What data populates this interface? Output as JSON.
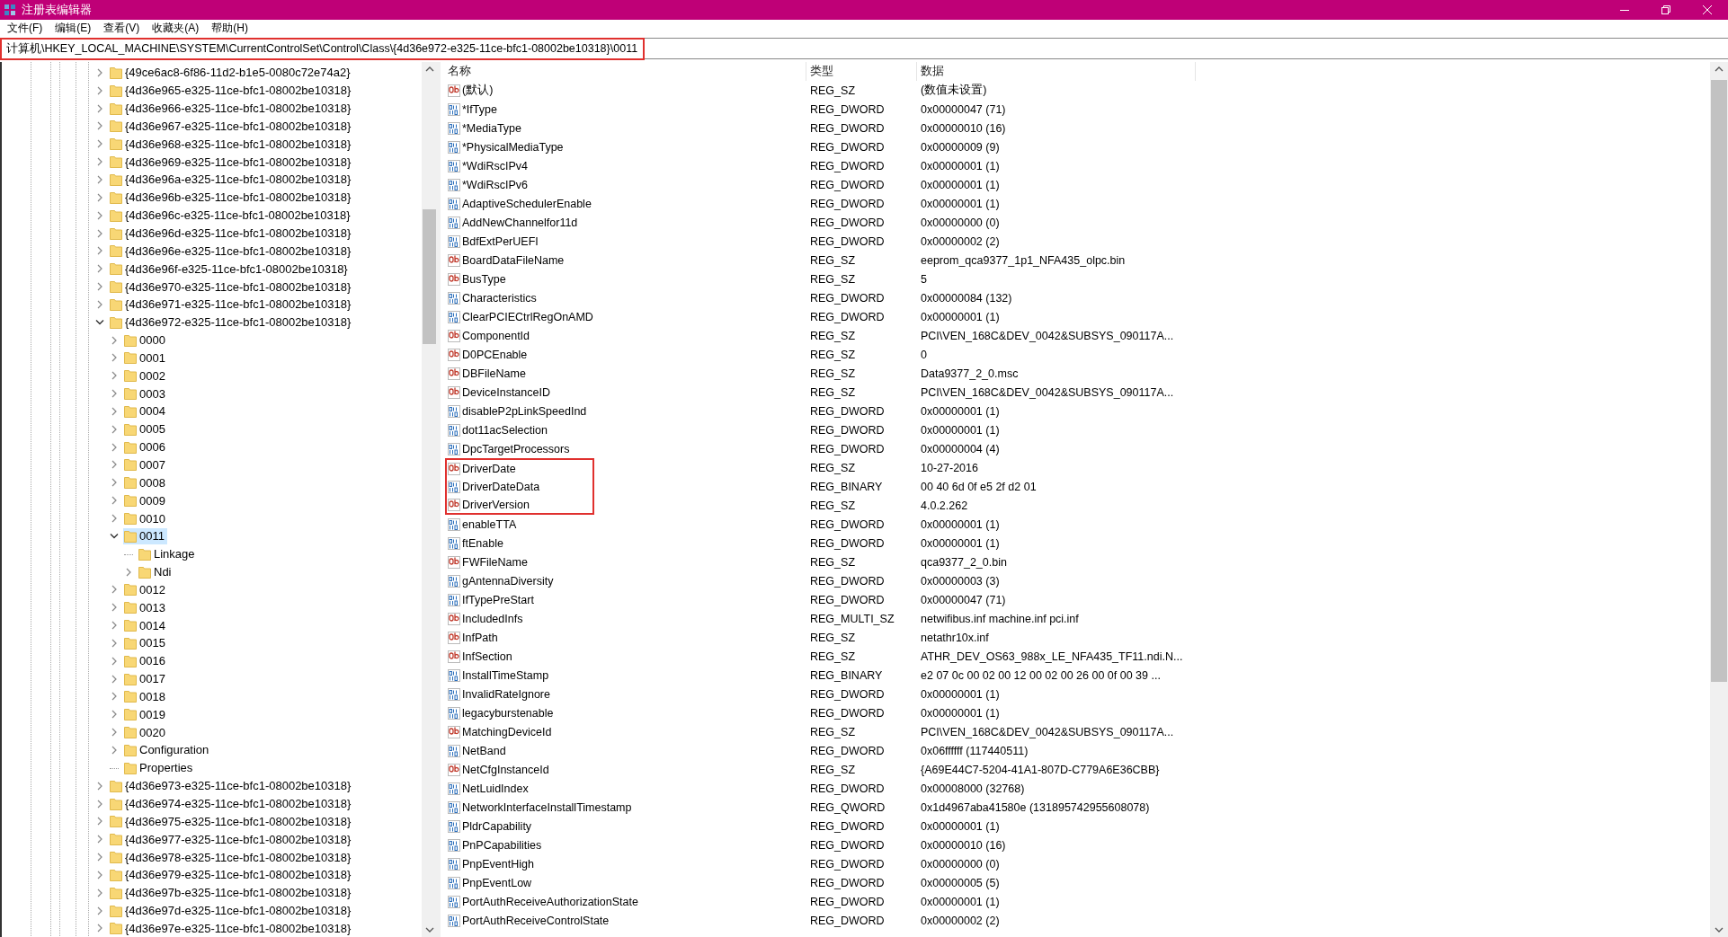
{
  "window": {
    "title": "注册表编辑器"
  },
  "menu": [
    "文件(F)",
    "编辑(E)",
    "查看(V)",
    "收藏夹(A)",
    "帮助(H)"
  ],
  "address": {
    "value": "计算机\\HKEY_LOCAL_MACHINE\\SYSTEM\\CurrentControlSet\\Control\\Class\\{4d36e972-e325-11ce-bfc1-08002be10318}\\0011",
    "highlighted": true
  },
  "tree": [
    {
      "label": "{49ce6ac8-6f86-11d2-b1e5-0080c72e74a2}",
      "expandable": true,
      "expanded": false,
      "selected": false
    },
    {
      "label": "{4d36e965-e325-11ce-bfc1-08002be10318}",
      "expandable": true,
      "expanded": false,
      "selected": false
    },
    {
      "label": "{4d36e966-e325-11ce-bfc1-08002be10318}",
      "expandable": true,
      "expanded": false,
      "selected": false
    },
    {
      "label": "{4d36e967-e325-11ce-bfc1-08002be10318}",
      "expandable": true,
      "expanded": false,
      "selected": false
    },
    {
      "label": "{4d36e968-e325-11ce-bfc1-08002be10318}",
      "expandable": true,
      "expanded": false,
      "selected": false
    },
    {
      "label": "{4d36e969-e325-11ce-bfc1-08002be10318}",
      "expandable": true,
      "expanded": false,
      "selected": false
    },
    {
      "label": "{4d36e96a-e325-11ce-bfc1-08002be10318}",
      "expandable": true,
      "expanded": false,
      "selected": false
    },
    {
      "label": "{4d36e96b-e325-11ce-bfc1-08002be10318}",
      "expandable": true,
      "expanded": false,
      "selected": false
    },
    {
      "label": "{4d36e96c-e325-11ce-bfc1-08002be10318}",
      "expandable": true,
      "expanded": false,
      "selected": false
    },
    {
      "label": "{4d36e96d-e325-11ce-bfc1-08002be10318}",
      "expandable": true,
      "expanded": false,
      "selected": false
    },
    {
      "label": "{4d36e96e-e325-11ce-bfc1-08002be10318}",
      "expandable": true,
      "expanded": false,
      "selected": false
    },
    {
      "label": "{4d36e96f-e325-11ce-bfc1-08002be10318}",
      "expandable": true,
      "expanded": false,
      "selected": false
    },
    {
      "label": "{4d36e970-e325-11ce-bfc1-08002be10318}",
      "expandable": true,
      "expanded": false,
      "selected": false
    },
    {
      "label": "{4d36e971-e325-11ce-bfc1-08002be10318}",
      "expandable": true,
      "expanded": false,
      "selected": false
    },
    {
      "label": "{4d36e972-e325-11ce-bfc1-08002be10318}",
      "expandable": true,
      "expanded": true,
      "selected": false,
      "children": [
        {
          "label": "0000",
          "expandable": true,
          "expanded": false,
          "selected": false
        },
        {
          "label": "0001",
          "expandable": true,
          "expanded": false,
          "selected": false
        },
        {
          "label": "0002",
          "expandable": true,
          "expanded": false,
          "selected": false
        },
        {
          "label": "0003",
          "expandable": true,
          "expanded": false,
          "selected": false
        },
        {
          "label": "0004",
          "expandable": true,
          "expanded": false,
          "selected": false
        },
        {
          "label": "0005",
          "expandable": true,
          "expanded": false,
          "selected": false
        },
        {
          "label": "0006",
          "expandable": true,
          "expanded": false,
          "selected": false
        },
        {
          "label": "0007",
          "expandable": true,
          "expanded": false,
          "selected": false
        },
        {
          "label": "0008",
          "expandable": true,
          "expanded": false,
          "selected": false
        },
        {
          "label": "0009",
          "expandable": true,
          "expanded": false,
          "selected": false
        },
        {
          "label": "0010",
          "expandable": true,
          "expanded": false,
          "selected": false
        },
        {
          "label": "0011",
          "expandable": true,
          "expanded": true,
          "selected": true,
          "children": [
            {
              "label": "Linkage",
              "expandable": false,
              "selected": false
            },
            {
              "label": "Ndi",
              "expandable": true,
              "expanded": false,
              "selected": false
            }
          ]
        },
        {
          "label": "0012",
          "expandable": true,
          "expanded": false,
          "selected": false
        },
        {
          "label": "0013",
          "expandable": true,
          "expanded": false,
          "selected": false
        },
        {
          "label": "0014",
          "expandable": true,
          "expanded": false,
          "selected": false
        },
        {
          "label": "0015",
          "expandable": true,
          "expanded": false,
          "selected": false
        },
        {
          "label": "0016",
          "expandable": true,
          "expanded": false,
          "selected": false
        },
        {
          "label": "0017",
          "expandable": true,
          "expanded": false,
          "selected": false
        },
        {
          "label": "0018",
          "expandable": true,
          "expanded": false,
          "selected": false
        },
        {
          "label": "0019",
          "expandable": true,
          "expanded": false,
          "selected": false
        },
        {
          "label": "0020",
          "expandable": true,
          "expanded": false,
          "selected": false
        },
        {
          "label": "Configuration",
          "expandable": true,
          "expanded": false,
          "selected": false
        },
        {
          "label": "Properties",
          "expandable": false,
          "selected": false
        }
      ]
    },
    {
      "label": "{4d36e973-e325-11ce-bfc1-08002be10318}",
      "expandable": true,
      "expanded": false,
      "selected": false
    },
    {
      "label": "{4d36e974-e325-11ce-bfc1-08002be10318}",
      "expandable": true,
      "expanded": false,
      "selected": false
    },
    {
      "label": "{4d36e975-e325-11ce-bfc1-08002be10318}",
      "expandable": true,
      "expanded": false,
      "selected": false
    },
    {
      "label": "{4d36e977-e325-11ce-bfc1-08002be10318}",
      "expandable": true,
      "expanded": false,
      "selected": false
    },
    {
      "label": "{4d36e978-e325-11ce-bfc1-08002be10318}",
      "expandable": true,
      "expanded": false,
      "selected": false
    },
    {
      "label": "{4d36e979-e325-11ce-bfc1-08002be10318}",
      "expandable": true,
      "expanded": false,
      "selected": false
    },
    {
      "label": "{4d36e97b-e325-11ce-bfc1-08002be10318}",
      "expandable": true,
      "expanded": false,
      "selected": false
    },
    {
      "label": "{4d36e97d-e325-11ce-bfc1-08002be10318}",
      "expandable": true,
      "expanded": false,
      "selected": false
    },
    {
      "label": "{4d36e97e-e325-11ce-bfc1-08002be10318}",
      "expandable": true,
      "expanded": false,
      "selected": false
    }
  ],
  "list": {
    "columns": [
      "名称",
      "类型",
      "数据"
    ],
    "rows": [
      {
        "kind": "string",
        "name": "(默认)",
        "type": "REG_SZ",
        "data": "(数值未设置)",
        "highlighted": false
      },
      {
        "kind": "binary",
        "name": "*IfType",
        "type": "REG_DWORD",
        "data": "0x00000047 (71)",
        "highlighted": false
      },
      {
        "kind": "binary",
        "name": "*MediaType",
        "type": "REG_DWORD",
        "data": "0x00000010 (16)",
        "highlighted": false
      },
      {
        "kind": "binary",
        "name": "*PhysicalMediaType",
        "type": "REG_DWORD",
        "data": "0x00000009 (9)",
        "highlighted": false
      },
      {
        "kind": "binary",
        "name": "*WdiRscIPv4",
        "type": "REG_DWORD",
        "data": "0x00000001 (1)",
        "highlighted": false
      },
      {
        "kind": "binary",
        "name": "*WdiRscIPv6",
        "type": "REG_DWORD",
        "data": "0x00000001 (1)",
        "highlighted": false
      },
      {
        "kind": "binary",
        "name": "AdaptiveSchedulerEnable",
        "type": "REG_DWORD",
        "data": "0x00000001 (1)",
        "highlighted": false
      },
      {
        "kind": "binary",
        "name": "AddNewChannelfor11d",
        "type": "REG_DWORD",
        "data": "0x00000000 (0)",
        "highlighted": false
      },
      {
        "kind": "binary",
        "name": "BdfExtPerUEFI",
        "type": "REG_DWORD",
        "data": "0x00000002 (2)",
        "highlighted": false
      },
      {
        "kind": "string",
        "name": "BoardDataFileName",
        "type": "REG_SZ",
        "data": "eeprom_qca9377_1p1_NFA435_olpc.bin",
        "highlighted": false
      },
      {
        "kind": "string",
        "name": "BusType",
        "type": "REG_SZ",
        "data": "5",
        "highlighted": false
      },
      {
        "kind": "binary",
        "name": "Characteristics",
        "type": "REG_DWORD",
        "data": "0x00000084 (132)",
        "highlighted": false
      },
      {
        "kind": "binary",
        "name": "ClearPCIECtrlRegOnAMD",
        "type": "REG_DWORD",
        "data": "0x00000001 (1)",
        "highlighted": false
      },
      {
        "kind": "string",
        "name": "ComponentId",
        "type": "REG_SZ",
        "data": "PCI\\VEN_168C&DEV_0042&SUBSYS_090117A...",
        "highlighted": false
      },
      {
        "kind": "string",
        "name": "D0PCEnable",
        "type": "REG_SZ",
        "data": "0",
        "highlighted": false
      },
      {
        "kind": "string",
        "name": "DBFileName",
        "type": "REG_SZ",
        "data": "Data9377_2_0.msc",
        "highlighted": false
      },
      {
        "kind": "string",
        "name": "DeviceInstanceID",
        "type": "REG_SZ",
        "data": "PCI\\VEN_168C&DEV_0042&SUBSYS_090117A...",
        "highlighted": false
      },
      {
        "kind": "binary",
        "name": "disableP2pLinkSpeedInd",
        "type": "REG_DWORD",
        "data": "0x00000001 (1)",
        "highlighted": false
      },
      {
        "kind": "binary",
        "name": "dot11acSelection",
        "type": "REG_DWORD",
        "data": "0x00000001 (1)",
        "highlighted": false
      },
      {
        "kind": "binary",
        "name": "DpcTargetProcessors",
        "type": "REG_DWORD",
        "data": "0x00000004 (4)",
        "highlighted": false
      },
      {
        "kind": "string",
        "name": "DriverDate",
        "type": "REG_SZ",
        "data": "10-27-2016",
        "highlighted": true
      },
      {
        "kind": "binary",
        "name": "DriverDateData",
        "type": "REG_BINARY",
        "data": "00 40 6d 0f e5 2f d2 01",
        "highlighted": true
      },
      {
        "kind": "string",
        "name": "DriverVersion",
        "type": "REG_SZ",
        "data": "4.0.2.262",
        "highlighted": true
      },
      {
        "kind": "binary",
        "name": "enableTTA",
        "type": "REG_DWORD",
        "data": "0x00000001 (1)",
        "highlighted": false
      },
      {
        "kind": "binary",
        "name": "ftEnable",
        "type": "REG_DWORD",
        "data": "0x00000001 (1)",
        "highlighted": false
      },
      {
        "kind": "string",
        "name": "FWFileName",
        "type": "REG_SZ",
        "data": "qca9377_2_0.bin",
        "highlighted": false
      },
      {
        "kind": "binary",
        "name": "gAntennaDiversity",
        "type": "REG_DWORD",
        "data": "0x00000003 (3)",
        "highlighted": false
      },
      {
        "kind": "binary",
        "name": "IfTypePreStart",
        "type": "REG_DWORD",
        "data": "0x00000047 (71)",
        "highlighted": false
      },
      {
        "kind": "string",
        "name": "IncludedInfs",
        "type": "REG_MULTI_SZ",
        "data": "netwifibus.inf machine.inf pci.inf",
        "highlighted": false
      },
      {
        "kind": "string",
        "name": "InfPath",
        "type": "REG_SZ",
        "data": "netathr10x.inf",
        "highlighted": false
      },
      {
        "kind": "string",
        "name": "InfSection",
        "type": "REG_SZ",
        "data": "ATHR_DEV_OS63_988x_LE_NFA435_TF11.ndi.N...",
        "highlighted": false
      },
      {
        "kind": "binary",
        "name": "InstallTimeStamp",
        "type": "REG_BINARY",
        "data": "e2 07 0c 00 02 00 12 00 02 00 26 00 0f 00 39 ...",
        "highlighted": false
      },
      {
        "kind": "binary",
        "name": "InvalidRateIgnore",
        "type": "REG_DWORD",
        "data": "0x00000001 (1)",
        "highlighted": false
      },
      {
        "kind": "binary",
        "name": "legacyburstenable",
        "type": "REG_DWORD",
        "data": "0x00000001 (1)",
        "highlighted": false
      },
      {
        "kind": "string",
        "name": "MatchingDeviceId",
        "type": "REG_SZ",
        "data": "PCI\\VEN_168C&DEV_0042&SUBSYS_090117A...",
        "highlighted": false
      },
      {
        "kind": "binary",
        "name": "NetBand",
        "type": "REG_DWORD",
        "data": "0x06ffffff (117440511)",
        "highlighted": false
      },
      {
        "kind": "string",
        "name": "NetCfgInstanceId",
        "type": "REG_SZ",
        "data": "{A69E44C7-5204-41A1-807D-C779A6E36CBB}",
        "highlighted": false
      },
      {
        "kind": "binary",
        "name": "NetLuidIndex",
        "type": "REG_DWORD",
        "data": "0x00008000 (32768)",
        "highlighted": false
      },
      {
        "kind": "binary",
        "name": "NetworkInterfaceInstallTimestamp",
        "type": "REG_QWORD",
        "data": "0x1d4967aba41580e (131895742955608078)",
        "highlighted": false
      },
      {
        "kind": "binary",
        "name": "PldrCapability",
        "type": "REG_DWORD",
        "data": "0x00000001 (1)",
        "highlighted": false
      },
      {
        "kind": "binary",
        "name": "PnPCapabilities",
        "type": "REG_DWORD",
        "data": "0x00000010 (16)",
        "highlighted": false
      },
      {
        "kind": "binary",
        "name": "PnpEventHigh",
        "type": "REG_DWORD",
        "data": "0x00000000 (0)",
        "highlighted": false
      },
      {
        "kind": "binary",
        "name": "PnpEventLow",
        "type": "REG_DWORD",
        "data": "0x00000005 (5)",
        "highlighted": false
      },
      {
        "kind": "binary",
        "name": "PortAuthReceiveAuthorizationState",
        "type": "REG_DWORD",
        "data": "0x00000001 (1)",
        "highlighted": false
      },
      {
        "kind": "binary",
        "name": "PortAuthReceiveControlState",
        "type": "REG_DWORD",
        "data": "0x00000002 (2)",
        "highlighted": false
      }
    ]
  }
}
